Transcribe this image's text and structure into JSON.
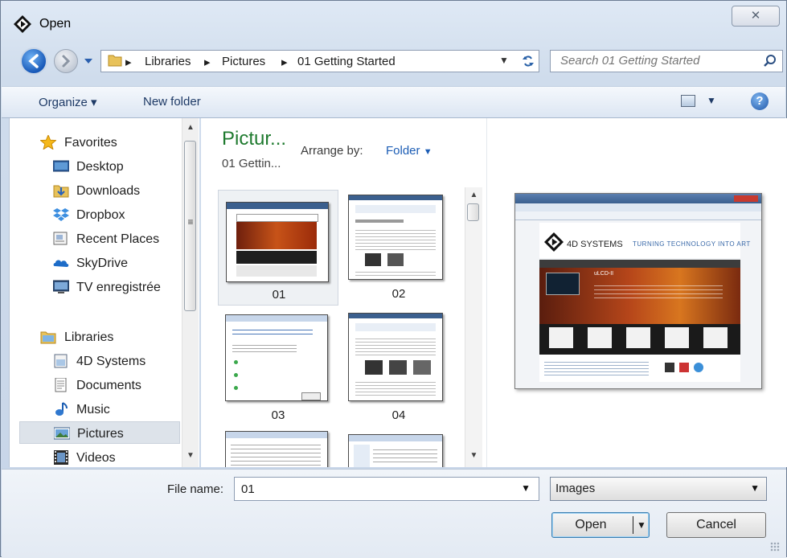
{
  "window": {
    "title": "Open",
    "close_glyph": "✕"
  },
  "nav": {
    "breadcrumbs": [
      "Libraries",
      "Pictures",
      "01 Getting Started"
    ],
    "search_placeholder": "Search 01 Getting Started"
  },
  "toolbar": {
    "organize": "Organize ▾",
    "new_folder": "New folder",
    "help": "?"
  },
  "sidebar": {
    "favorites_header": "Favorites",
    "favorites": [
      "Desktop",
      "Downloads",
      "Dropbox",
      "Recent Places",
      "SkyDrive",
      "TV enregistrée"
    ],
    "libraries_header": "Libraries",
    "libraries": [
      "4D Systems",
      "Documents",
      "Music",
      "Pictures",
      "Videos"
    ],
    "selected": "Pictures"
  },
  "library": {
    "title": "Pictur...",
    "subtitle": "01 Gettin...",
    "arrange_label": "Arrange by:",
    "arrange_value": "Folder"
  },
  "files": [
    {
      "label": "01",
      "selected": true
    },
    {
      "label": "02",
      "selected": false
    },
    {
      "label": "03",
      "selected": false
    },
    {
      "label": "04",
      "selected": false
    },
    {
      "label": "",
      "selected": false
    },
    {
      "label": "",
      "selected": false
    }
  ],
  "preview": {
    "site_name": "4D SYSTEMS",
    "tagline": "TURNING TECHNOLOGY INTO ART",
    "heading": "uLCD-II"
  },
  "bottom": {
    "file_name_label": "File name:",
    "file_name_value": "01",
    "file_type": "Images",
    "open_label": "Open",
    "cancel_label": "Cancel"
  },
  "colors": {
    "library_title": "#1e7a2e",
    "link_blue": "#1c5db5",
    "selection": "#dde3ea"
  }
}
